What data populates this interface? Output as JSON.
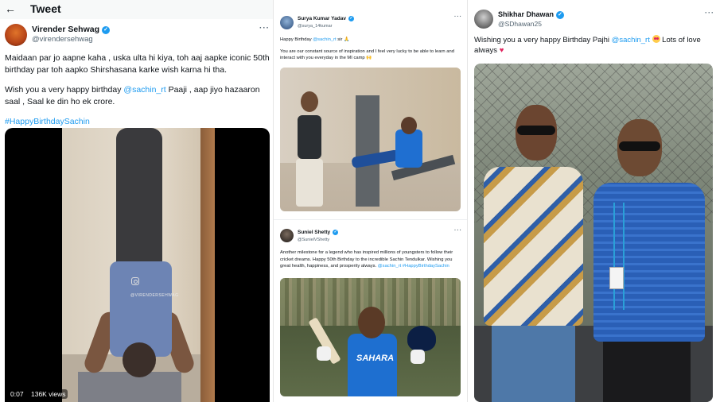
{
  "col1": {
    "heading": "Tweet",
    "back_icon": "back-arrow-icon",
    "author": {
      "name": "Virender Sehwag",
      "handle": "@virendersehwag"
    },
    "text_p1": "Maidaan par jo aapne kaha , uska ulta hi kiya, toh aaj aapke iconic 50th birthday par toh aapko Shirshasana karke wish karna hi tha.",
    "text_p2_before": "Wish you a very happy birthday ",
    "text_p2_mention": "@sachin_rt",
    "text_p2_after": " Paaji , aap jiyo hazaaron saal , Saal ke din ho ek crore.",
    "hashtag": "#HappyBirthdaySachin",
    "video": {
      "time": "0:07",
      "views": "136K views",
      "watermark": "@VIRENDERSEHWAG"
    }
  },
  "col2": {
    "tweet1": {
      "author": {
        "name": "Surya Kumar Yadav",
        "handle": "@surya_14kumar"
      },
      "line1_before": "Happy Birthday ",
      "line1_mention": "@sachin_rt",
      "line1_after": " sir 🙏",
      "line2": "You are our constant source of inspiration and I feel very lucky to be able to learn and interact with you everyday in the MI camp 🙌"
    },
    "tweet2": {
      "author": {
        "name": "Suniel Shetty",
        "handle": "@SunielVShetty"
      },
      "text": "Another milestone for a legend who has inspired millions of youngsters to follow their cricket dreams. Happy 50th Birthday to the incredible Sachin Tendulkar. Wishing you great health, happiness, and prosperity always. ",
      "mention": "@sachin_rt",
      "hashtag": " #HappyBirthdaySachin",
      "jersey": "SAHARA"
    }
  },
  "col3": {
    "author": {
      "name": "Shikhar Dhawan",
      "handle": "@SDhawan25"
    },
    "text_before": "Wishing you a very happy Birthday Pajhi ",
    "mention": "@sachin_rt",
    "text_after": " Lots of love always "
  },
  "colors": {
    "link": "#1d9bf0",
    "verified": "#1d9bf0",
    "text": "#0f1419",
    "muted": "#536471"
  }
}
